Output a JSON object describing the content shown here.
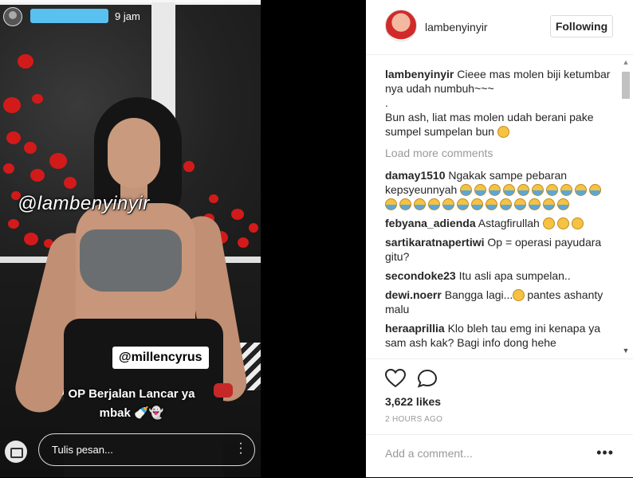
{
  "story": {
    "time": "9 jam",
    "handle_sticker": "@lambenyinyir",
    "mention_sticker": "@millencyrus",
    "caption_line1": "OP Berjalan Lancar ya",
    "caption_line2": "mbak",
    "message_placeholder": "Tulis pesan..."
  },
  "post": {
    "username": "lambenyinyir",
    "follow_label": "Following",
    "caption": {
      "user": "lambenyinyir",
      "line1": "Cieee mas molen biji ketumbar nya udah numbuh~~~",
      "line2": ".",
      "line3": "Bun ash, liat mas molen udah berani pake sumpel sumpelan bun"
    },
    "load_more": "Load more comments",
    "comments": [
      {
        "user": "damay1510",
        "text": "Ngakak sampe pebaran kepsyeunnyah"
      },
      {
        "user": "febyana_adienda",
        "text": "Astagfirullah"
      },
      {
        "user": "sartikaratnapertiwi",
        "text": "Op = operasi payudara gitu?"
      },
      {
        "user": "secondoke23",
        "text": "Itu asli apa sumpelan.."
      },
      {
        "user": "dewi.noerr",
        "text_a": "Bangga lagi...",
        "text_b": "pantes ashanty malu"
      },
      {
        "user": "heraaprillia",
        "text": "Klo bleh tau emg ini kenapa ya sam ash kak? Bagi info dong hehe"
      }
    ],
    "likes": "3,622 likes",
    "time_ago": "2 HOURS AGO",
    "add_comment_placeholder": "Add a comment...",
    "more_menu": "•••"
  },
  "colors": {
    "story_username_bar": "#59c1f0",
    "wall_dots": "#d31a1a",
    "text": "#262626",
    "muted": "#999999"
  }
}
